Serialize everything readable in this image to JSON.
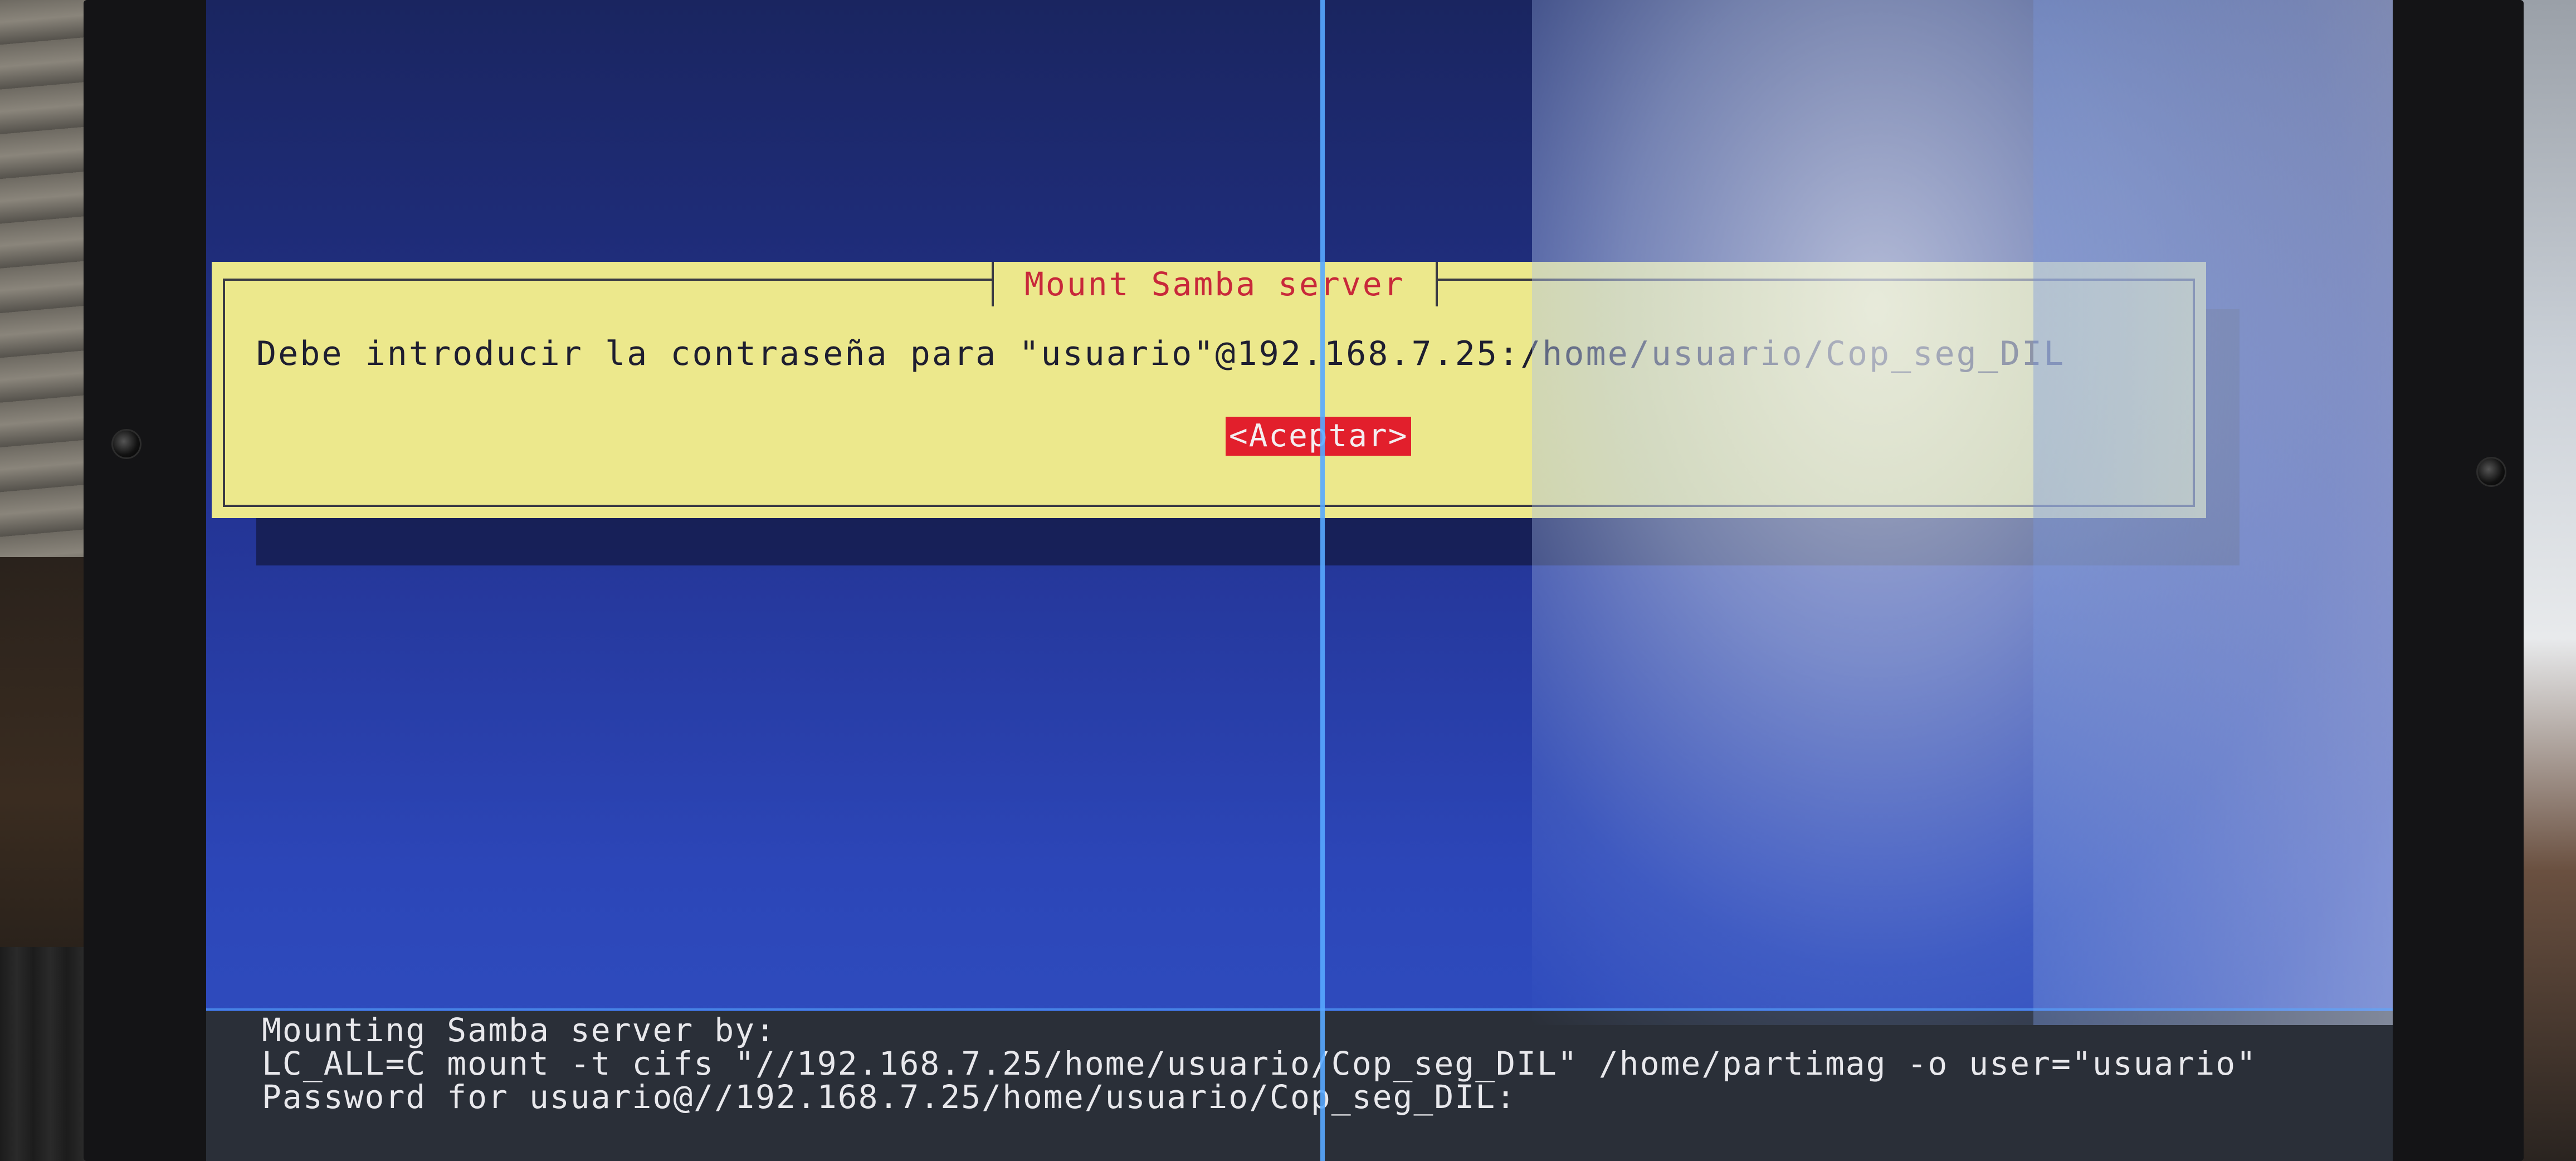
{
  "dialog": {
    "title": "Mount Samba server",
    "message": "Debe introducir la contraseña para \"usuario\"@192.168.7.25:/home/usuario/Cop_seg_DIL",
    "accept_button": "<Aceptar>"
  },
  "console": {
    "lines": [
      "Mounting Samba server by:",
      "LC_ALL=C mount -t cifs \"//192.168.7.25/home/usuario/Cop_seg_DIL\" /home/partimag -o user=\"usuario\"",
      "Password for usuario@//192.168.7.25/home/usuario/Cop_seg_DIL:"
    ]
  },
  "colors": {
    "background": "#243596",
    "dialog": "#ece88c",
    "title_text": "#c8283a",
    "button": "#e21f2c",
    "console": "#2a2f38"
  }
}
